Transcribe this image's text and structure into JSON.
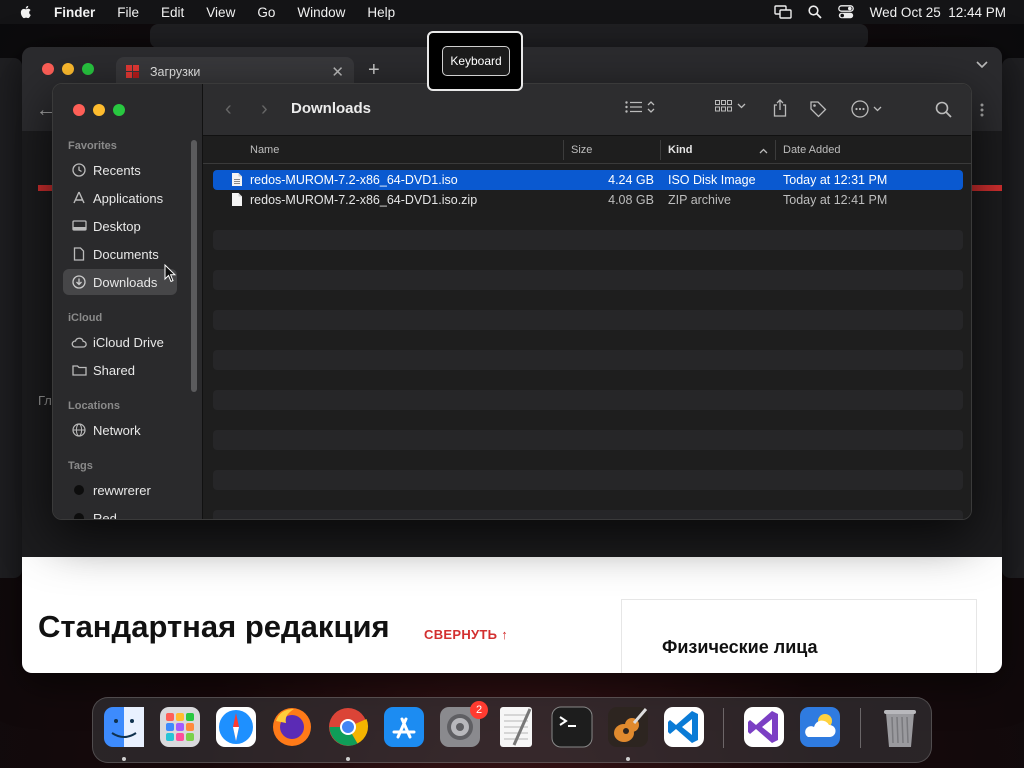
{
  "menubar": {
    "app_name": "Finder",
    "menus": [
      "File",
      "Edit",
      "View",
      "Go",
      "Window",
      "Help"
    ],
    "datetime": "Wed Oct 25  12:44 PM"
  },
  "browser": {
    "tab_title": "Загрузки",
    "left_partial_text": "Гл",
    "edition_title": "Стандартная редакция",
    "collapse_link": "СВЕРНУТЬ ↑",
    "card_title": "Физические лица"
  },
  "keyboard_hud": {
    "label": "Keyboard"
  },
  "finder": {
    "title": "Downloads",
    "sidebar": {
      "favorites_label": "Favorites",
      "favorites": [
        {
          "label": "Recents",
          "icon": "clock-icon"
        },
        {
          "label": "Applications",
          "icon": "apps-icon"
        },
        {
          "label": "Desktop",
          "icon": "desktop-icon"
        },
        {
          "label": "Documents",
          "icon": "document-icon"
        },
        {
          "label": "Downloads",
          "icon": "download-icon",
          "active": true
        }
      ],
      "icloud_label": "iCloud",
      "icloud": [
        {
          "label": "iCloud Drive",
          "icon": "cloud-icon"
        },
        {
          "label": "Shared",
          "icon": "shared-folder-icon"
        }
      ],
      "locations_label": "Locations",
      "locations": [
        {
          "label": "Network",
          "icon": "globe-icon"
        }
      ],
      "tags_label": "Tags",
      "tags": [
        {
          "label": "rewwrerer",
          "color": "#0d0d0d"
        },
        {
          "label": "Red",
          "color": "#0d0d0d"
        }
      ]
    },
    "columns": {
      "name": "Name",
      "size": "Size",
      "kind": "Kind",
      "date_added": "Date Added"
    },
    "files": [
      {
        "name": "redos-MUROM-7.2-x86_64-DVD1.iso",
        "size": "4.24 GB",
        "kind": "ISO Disk Image",
        "date_added": "Today at 12:31 PM",
        "selected": true
      },
      {
        "name": "redos-MUROM-7.2-x86_64-DVD1.iso.zip",
        "size": "4.08 GB",
        "kind": "ZIP archive",
        "date_added": "Today at 12:41 PM",
        "selected": false
      }
    ]
  },
  "dock": {
    "apps": [
      {
        "name": "finder-icon",
        "running": true
      },
      {
        "name": "launchpad-icon",
        "running": false
      },
      {
        "name": "safari-icon",
        "running": false
      },
      {
        "name": "firefox-icon",
        "running": false
      },
      {
        "name": "chrome-icon",
        "running": true
      },
      {
        "name": "app-store-icon",
        "running": false
      },
      {
        "name": "system-settings-icon",
        "running": false,
        "badge": "2"
      },
      {
        "name": "textedit-icon",
        "running": false
      },
      {
        "name": "terminal-icon",
        "running": false
      },
      {
        "name": "garageband-icon",
        "running": true
      },
      {
        "name": "vscode-icon",
        "running": false
      },
      {
        "name": "visual-studio-icon",
        "running": false
      },
      {
        "name": "weather-icon",
        "running": false
      },
      {
        "name": "trash-icon",
        "running": false
      }
    ]
  },
  "colors": {
    "selection": "#0a59d0",
    "accent_red": "#d32f2f"
  }
}
